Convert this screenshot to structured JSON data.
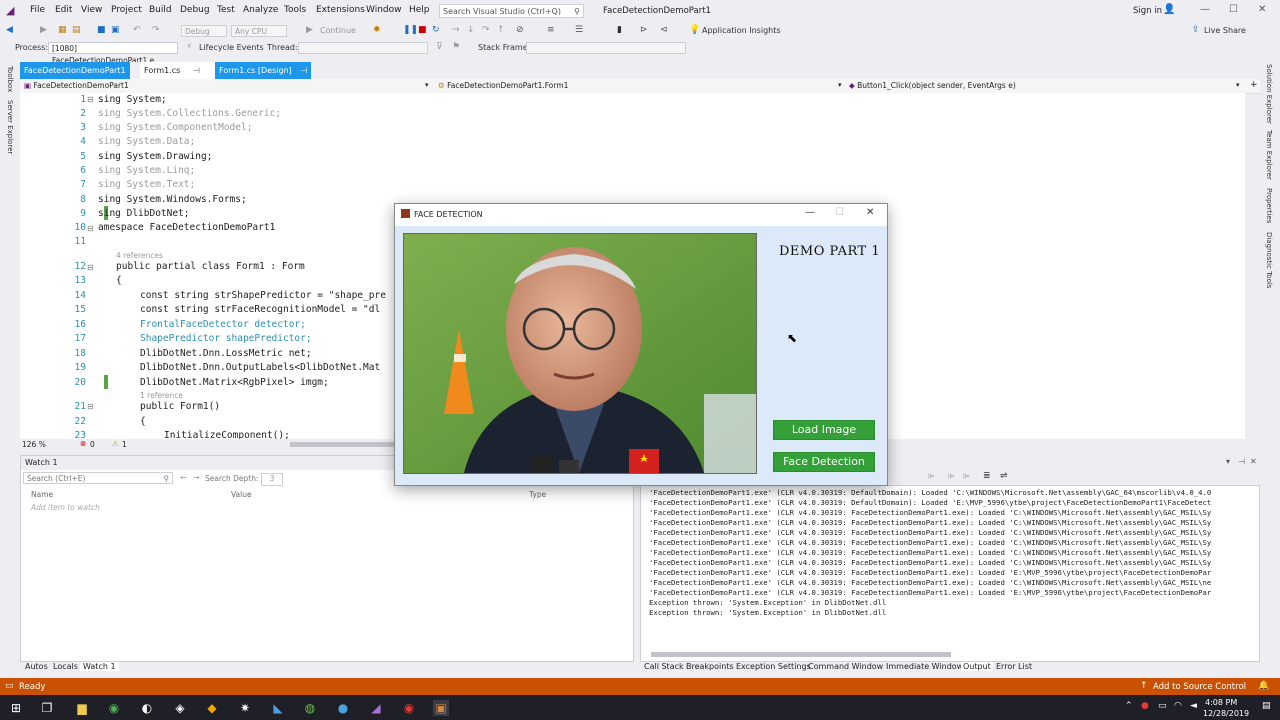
{
  "menu": [
    "File",
    "Edit",
    "View",
    "Project",
    "Build",
    "Debug",
    "Test",
    "Analyze",
    "Tools",
    "Extensions",
    "Window",
    "Help"
  ],
  "search_placeholder": "Search Visual Studio (Ctrl+Q)",
  "app_title": "FaceDetectionDemoPart1",
  "sign_in": "Sign in",
  "toolbar": {
    "config": "Debug",
    "platform": "Any CPU",
    "continue": "Continue",
    "app_insights": "Application Insights",
    "live_share": "Live Share",
    "process_label": "Process:",
    "process_value": "[1080] FaceDetectionDemoPart1.e",
    "lifecycle": "Lifecycle Events",
    "thread": "Thread:",
    "stack_frame": "Stack Frame:"
  },
  "left_strip": [
    "Toolbox",
    "Server Explorer"
  ],
  "right_strip": [
    "Solution Explorer",
    "Team Explorer",
    "Properties",
    "Diagnostic Tools"
  ],
  "doc_tabs": [
    "FaceDetectionDemoPart1",
    "Form1.cs",
    "Form1.cs [Design]"
  ],
  "nav": {
    "project": "FaceDetectionDemoPart1",
    "class": "FaceDetectionDemoPart1.Form1",
    "member": "Button1_Click(object sender, EventArgs e)"
  },
  "code_lines": [
    {
      "n": "1",
      "text": "sing System;"
    },
    {
      "n": "2",
      "text": "sing System.Collections.Generic;"
    },
    {
      "n": "3",
      "text": "sing System.ComponentModel;"
    },
    {
      "n": "4",
      "text": "sing System.Data;"
    },
    {
      "n": "5",
      "text": "sing System.Drawing;"
    },
    {
      "n": "6",
      "text": "sing System.Linq;"
    },
    {
      "n": "7",
      "text": "sing System.Text;"
    },
    {
      "n": "8",
      "text": "sing System.Windows.Forms;"
    },
    {
      "n": "9",
      "text": "sing DlibDotNet;"
    },
    {
      "n": "10",
      "text": "amespace FaceDetectionDemoPart1"
    },
    {
      "n": "11",
      "text": ""
    },
    {
      "n": "12",
      "text": "public partial class Form1 : Form"
    },
    {
      "n": "13",
      "text": "{"
    },
    {
      "n": "14",
      "text": "const string strShapePredictor = \"shape_pre"
    },
    {
      "n": "15",
      "text": "const string strFaceRecognitionModel = \"dl"
    },
    {
      "n": "16",
      "text": "FrontalFaceDetector detector;"
    },
    {
      "n": "17",
      "text": "ShapePredictor shapePredictor;"
    },
    {
      "n": "18",
      "text": "DlibDotNet.Dnn.LossMetric net;"
    },
    {
      "n": "19",
      "text": "DlibDotNet.Dnn.OutputLabels<DlibDotNet.Mat"
    },
    {
      "n": "20",
      "text": "DlibDotNet.Matrix<RgbPixel> imgm;"
    },
    {
      "n": "21",
      "text": "public Form1()"
    },
    {
      "n": "22",
      "text": "{"
    },
    {
      "n": "23",
      "text": "InitializeComponent();"
    }
  ],
  "refs": {
    "four": "4 references",
    "one": "1 reference"
  },
  "editor_status": {
    "zoom": "126 %",
    "errors": "0",
    "warnings": "1"
  },
  "watch": {
    "title": "Watch 1",
    "search": "Search (Ctrl+E)",
    "search_depth": "Search Depth:",
    "depth_value": "3",
    "col_name": "Name",
    "col_value": "Value",
    "col_type": "Type",
    "add_item": "Add item to watch"
  },
  "output_lines": [
    "'FaceDetectionDemoPart1.exe' (CLR v4.0.30319: DefaultDomain): Loaded 'C:\\WINDOWS\\Microsoft.Net\\assembly\\GAC_64\\mscorlib\\v4.0_4.0",
    "'FaceDetectionDemoPart1.exe' (CLR v4.0.30319: DefaultDomain): Loaded 'E:\\MVP_5996\\ytbe\\project\\FaceDetectionDemoPart1\\FaceDetect",
    "'FaceDetectionDemoPart1.exe' (CLR v4.0.30319: FaceDetectionDemoPart1.exe): Loaded 'C:\\WINDOWS\\Microsoft.Net\\assembly\\GAC_MSIL\\Sy",
    "'FaceDetectionDemoPart1.exe' (CLR v4.0.30319: FaceDetectionDemoPart1.exe): Loaded 'C:\\WINDOWS\\Microsoft.Net\\assembly\\GAC_MSIL\\Sy",
    "'FaceDetectionDemoPart1.exe' (CLR v4.0.30319: FaceDetectionDemoPart1.exe): Loaded 'C:\\WINDOWS\\Microsoft.Net\\assembly\\GAC_MSIL\\Sy",
    "'FaceDetectionDemoPart1.exe' (CLR v4.0.30319: FaceDetectionDemoPart1.exe): Loaded 'C:\\WINDOWS\\Microsoft.Net\\assembly\\GAC_MSIL\\Sy",
    "'FaceDetectionDemoPart1.exe' (CLR v4.0.30319: FaceDetectionDemoPart1.exe): Loaded 'C:\\WINDOWS\\Microsoft.Net\\assembly\\GAC_MSIL\\Sy",
    "'FaceDetectionDemoPart1.exe' (CLR v4.0.30319: FaceDetectionDemoPart1.exe): Loaded 'C:\\WINDOWS\\Microsoft.Net\\assembly\\GAC_MSIL\\Sy",
    "'FaceDetectionDemoPart1.exe' (CLR v4.0.30319: FaceDetectionDemoPart1.exe): Loaded 'E:\\MVP_5996\\ytbe\\project\\FaceDetectionDemoPar",
    "'FaceDetectionDemoPart1.exe' (CLR v4.0.30319: FaceDetectionDemoPart1.exe): Loaded 'C:\\WINDOWS\\Microsoft.Net\\assembly\\GAC_MSIL\\ne",
    "'FaceDetectionDemoPart1.exe' (CLR v4.0.30319: FaceDetectionDemoPart1.exe): Loaded 'E:\\MVP_5996\\ytbe\\project\\FaceDetectionDemoPar",
    "Exception thrown: 'System.Exception' in DlibDotNet.dll",
    "Exception thrown: 'System.Exception' in DlibDotNet.dll"
  ],
  "watch_tabs": [
    "Autos",
    "Locals",
    "Watch 1"
  ],
  "output_tabs": [
    "Call Stack",
    "Breakpoints",
    "Exception Settings",
    "Command Window",
    "Immediate Window",
    "Output",
    "Error List"
  ],
  "status": {
    "ready": "Ready",
    "source_control": "Add to Source Control"
  },
  "clock": {
    "time": "4:08 PM",
    "date": "12/28/2019"
  },
  "form": {
    "title": "FACE DETECTION",
    "heading": "DEMO PART 1",
    "load_button": "Load Image",
    "detect_button": "Face Detection"
  },
  "colors": {
    "status_bar": "#ca5100",
    "accent": "#007acc",
    "button_green": "#33a038"
  }
}
